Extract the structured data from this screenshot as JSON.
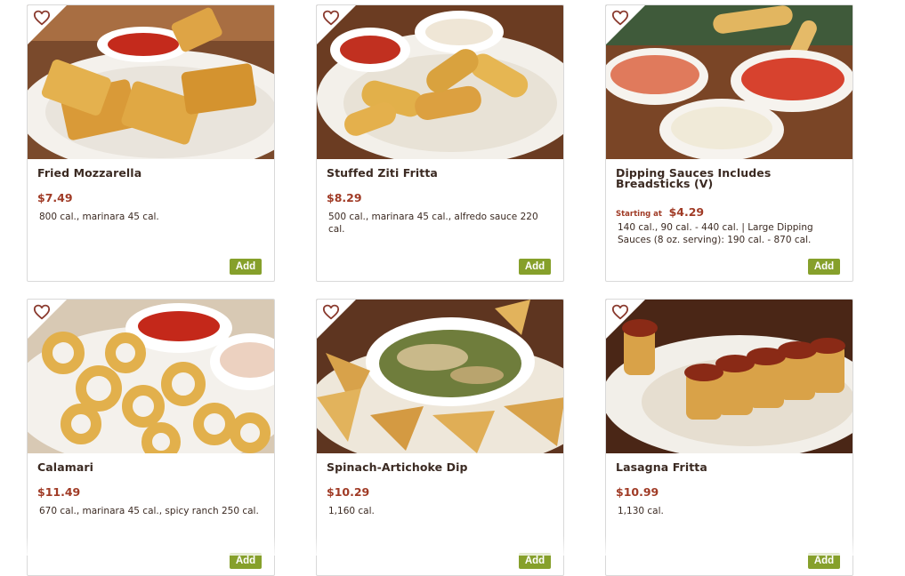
{
  "menu": {
    "items": [
      {
        "name": "Fried Mozzarella",
        "price": "$7.49",
        "calories": "800 cal., marinara 45 cal.",
        "add_label": "Add",
        "favorite_icon": "heart-outline-icon"
      },
      {
        "name": "Stuffed Ziti Fritta",
        "price": "$8.29",
        "calories": "500 cal., marinara 45 cal., alfredo sauce 220 cal.",
        "add_label": "Add",
        "favorite_icon": "heart-outline-icon"
      },
      {
        "name": "Dipping Sauces Includes Breadsticks (V)",
        "price_prefix": "Starting at",
        "price": "$4.29",
        "calories": "140 cal., 90 cal. - 440 cal. | Large Dipping Sauces (8 oz. serving): 190 cal. - 870 cal.",
        "add_label": "Add",
        "favorite_icon": "heart-outline-icon"
      },
      {
        "name": "Calamari",
        "price": "$11.49",
        "calories": "670 cal., marinara 45 cal., spicy ranch 250 cal.",
        "add_label": "Add",
        "favorite_icon": "heart-outline-icon"
      },
      {
        "name": "Spinach-Artichoke Dip",
        "price": "$10.29",
        "calories": "1,160 cal.",
        "add_label": "Add",
        "favorite_icon": "heart-outline-icon"
      },
      {
        "name": "Lasagna Fritta",
        "price": "$10.99",
        "calories": "1,130 cal.",
        "add_label": "Add",
        "favorite_icon": "heart-outline-icon"
      }
    ]
  },
  "colors": {
    "price": "#a03b26",
    "add_button": "#86a02b",
    "heading": "#3b2a22",
    "favorite": "#8a3a2e"
  }
}
